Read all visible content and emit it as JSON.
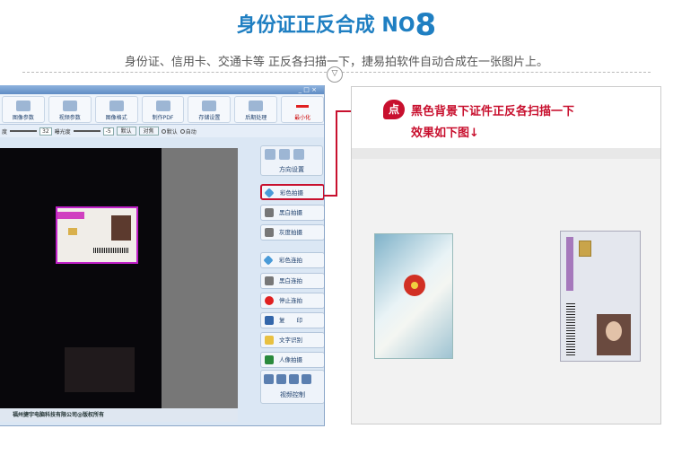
{
  "header": {
    "title": "身份证正反合成 NO",
    "title_num": "8",
    "subtitle": "身份证、信用卡、交通卡等 正反各扫描一下，捷易拍软件自动合成在一张图片上。",
    "divider_icon": "chevron-down-icon"
  },
  "software": {
    "window_controls": "_ □ ×",
    "toolbar": [
      {
        "name": "image-params",
        "label": "图像参数"
      },
      {
        "name": "video-params",
        "label": "视频参数"
      },
      {
        "name": "image-format",
        "label": "图像格式"
      },
      {
        "name": "make-pdf",
        "label": "制作PDF"
      },
      {
        "name": "storage-settings",
        "label": "存储设置"
      },
      {
        "name": "post-process",
        "label": "后期处理"
      },
      {
        "name": "minimize",
        "label": "最小化"
      }
    ],
    "controls": {
      "label_degree": "度",
      "value_a": "32",
      "label_exposure": "曝光度",
      "value_b": "-5",
      "btn_default": "默认",
      "btn_focus": "对焦",
      "radio_default": "默认",
      "radio_auto": "自动"
    },
    "orientation_label": "方向设置",
    "side_buttons": [
      {
        "name": "color-shot",
        "label": "彩色拍摄",
        "kind": "color"
      },
      {
        "name": "bw-shot",
        "label": "黑白拍摄",
        "kind": "gray"
      },
      {
        "name": "gray-shot",
        "label": "灰度拍摄",
        "kind": "gray"
      },
      {
        "name": "color-continuous",
        "label": "彩色连拍",
        "kind": "color"
      },
      {
        "name": "bw-continuous",
        "label": "黑白连拍",
        "kind": "gray"
      },
      {
        "name": "stop-continuous",
        "label": "停止连拍",
        "kind": "stop"
      },
      {
        "name": "copy",
        "label": "复　　印",
        "kind": "copy"
      },
      {
        "name": "ocr",
        "label": "文字识别",
        "kind": "ocr"
      },
      {
        "name": "portrait-shot",
        "label": "人像拍摄",
        "kind": "person"
      }
    ],
    "video_control_label": "视频控制",
    "copyright": "福州捷宇电脑科技有限公司@版权所有"
  },
  "panel": {
    "badge": "点",
    "note_line1": "黑色背景下证件正反各扫描一下",
    "note_line2": "效果如下图↓"
  },
  "colors": {
    "title_blue": "#1f7fc2",
    "accent_red": "#c8102e"
  }
}
